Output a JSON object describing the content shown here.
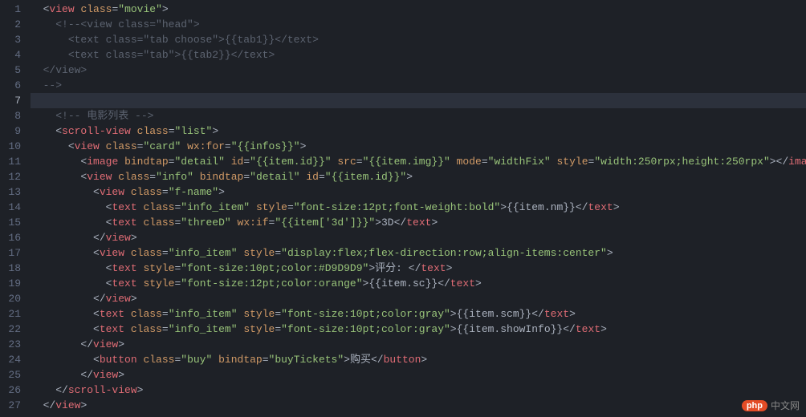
{
  "editor": {
    "highlighted_line": 7,
    "lines": [
      {
        "n": 1,
        "indent": 1,
        "tokens": [
          {
            "t": "p",
            "v": "<"
          },
          {
            "t": "tag",
            "v": "view"
          },
          {
            "t": "p",
            "v": " "
          },
          {
            "t": "attr",
            "v": "class"
          },
          {
            "t": "p",
            "v": "="
          },
          {
            "t": "str",
            "v": "\"movie\""
          },
          {
            "t": "p",
            "v": ">"
          }
        ]
      },
      {
        "n": 2,
        "indent": 2,
        "tokens": [
          {
            "t": "cmt",
            "v": "<!--<view class=\"head\">"
          }
        ]
      },
      {
        "n": 3,
        "indent": 2,
        "tokens": [
          {
            "t": "cmt",
            "v": "  <text class=\"tab choose\">{{tab1}}</text>"
          }
        ]
      },
      {
        "n": 4,
        "indent": 2,
        "tokens": [
          {
            "t": "cmt",
            "v": "  <text class=\"tab\">{{tab2}}</text>"
          }
        ]
      },
      {
        "n": 5,
        "indent": 1,
        "tokens": [
          {
            "t": "cmt",
            "v": "</view>"
          }
        ]
      },
      {
        "n": 6,
        "indent": 1,
        "tokens": [
          {
            "t": "cmt",
            "v": "-->"
          }
        ]
      },
      {
        "n": 7,
        "indent": 0,
        "tokens": []
      },
      {
        "n": 8,
        "indent": 2,
        "tokens": [
          {
            "t": "cmt",
            "v": "<!-- 电影列表 -->"
          }
        ]
      },
      {
        "n": 9,
        "indent": 2,
        "tokens": [
          {
            "t": "p",
            "v": "<"
          },
          {
            "t": "tag",
            "v": "scroll-view"
          },
          {
            "t": "p",
            "v": " "
          },
          {
            "t": "attr",
            "v": "class"
          },
          {
            "t": "p",
            "v": "="
          },
          {
            "t": "str",
            "v": "\"list\""
          },
          {
            "t": "p",
            "v": ">"
          }
        ]
      },
      {
        "n": 10,
        "indent": 3,
        "tokens": [
          {
            "t": "p",
            "v": "<"
          },
          {
            "t": "tag",
            "v": "view"
          },
          {
            "t": "p",
            "v": " "
          },
          {
            "t": "attr",
            "v": "class"
          },
          {
            "t": "p",
            "v": "="
          },
          {
            "t": "str",
            "v": "\"card\""
          },
          {
            "t": "p",
            "v": " "
          },
          {
            "t": "attr",
            "v": "wx:for"
          },
          {
            "t": "p",
            "v": "="
          },
          {
            "t": "str",
            "v": "\"{{infos}}\""
          },
          {
            "t": "p",
            "v": ">"
          }
        ]
      },
      {
        "n": 11,
        "indent": 4,
        "tokens": [
          {
            "t": "p",
            "v": "<"
          },
          {
            "t": "tag",
            "v": "image"
          },
          {
            "t": "p",
            "v": " "
          },
          {
            "t": "attr",
            "v": "bindtap"
          },
          {
            "t": "p",
            "v": "="
          },
          {
            "t": "str",
            "v": "\"detail\""
          },
          {
            "t": "p",
            "v": " "
          },
          {
            "t": "attr",
            "v": "id"
          },
          {
            "t": "p",
            "v": "="
          },
          {
            "t": "str",
            "v": "\"{{item.id}}\""
          },
          {
            "t": "p",
            "v": " "
          },
          {
            "t": "attr",
            "v": "src"
          },
          {
            "t": "p",
            "v": "="
          },
          {
            "t": "str",
            "v": "\"{{item.img}}\""
          },
          {
            "t": "p",
            "v": " "
          },
          {
            "t": "attr",
            "v": "mode"
          },
          {
            "t": "p",
            "v": "="
          },
          {
            "t": "str",
            "v": "\"widthFix\""
          },
          {
            "t": "p",
            "v": " "
          },
          {
            "t": "attr",
            "v": "style"
          },
          {
            "t": "p",
            "v": "="
          },
          {
            "t": "str",
            "v": "\"width:250rpx;height:250rpx\""
          },
          {
            "t": "p",
            "v": "></"
          },
          {
            "t": "tag",
            "v": "image"
          },
          {
            "t": "p",
            "v": ">"
          }
        ]
      },
      {
        "n": 12,
        "indent": 4,
        "tokens": [
          {
            "t": "p",
            "v": "<"
          },
          {
            "t": "tag",
            "v": "view"
          },
          {
            "t": "p",
            "v": " "
          },
          {
            "t": "attr",
            "v": "class"
          },
          {
            "t": "p",
            "v": "="
          },
          {
            "t": "str",
            "v": "\"info\""
          },
          {
            "t": "p",
            "v": " "
          },
          {
            "t": "attr",
            "v": "bindtap"
          },
          {
            "t": "p",
            "v": "="
          },
          {
            "t": "str",
            "v": "\"detail\""
          },
          {
            "t": "p",
            "v": " "
          },
          {
            "t": "attr",
            "v": "id"
          },
          {
            "t": "p",
            "v": "="
          },
          {
            "t": "str",
            "v": "\"{{item.id}}\""
          },
          {
            "t": "p",
            "v": ">"
          }
        ]
      },
      {
        "n": 13,
        "indent": 5,
        "tokens": [
          {
            "t": "p",
            "v": "<"
          },
          {
            "t": "tag",
            "v": "view"
          },
          {
            "t": "p",
            "v": " "
          },
          {
            "t": "attr",
            "v": "class"
          },
          {
            "t": "p",
            "v": "="
          },
          {
            "t": "str",
            "v": "\"f-name\""
          },
          {
            "t": "p",
            "v": ">"
          }
        ]
      },
      {
        "n": 14,
        "indent": 6,
        "tokens": [
          {
            "t": "p",
            "v": "<"
          },
          {
            "t": "tag",
            "v": "text"
          },
          {
            "t": "p",
            "v": " "
          },
          {
            "t": "attr",
            "v": "class"
          },
          {
            "t": "p",
            "v": "="
          },
          {
            "t": "str",
            "v": "\"info_item\""
          },
          {
            "t": "p",
            "v": " "
          },
          {
            "t": "attr",
            "v": "style"
          },
          {
            "t": "p",
            "v": "="
          },
          {
            "t": "str",
            "v": "\"font-size:12pt;font-weight:bold\""
          },
          {
            "t": "p",
            "v": ">"
          },
          {
            "t": "txt",
            "v": "{{item.nm}}"
          },
          {
            "t": "p",
            "v": "</"
          },
          {
            "t": "tag",
            "v": "text"
          },
          {
            "t": "p",
            "v": ">"
          }
        ]
      },
      {
        "n": 15,
        "indent": 6,
        "tokens": [
          {
            "t": "p",
            "v": "<"
          },
          {
            "t": "tag",
            "v": "text"
          },
          {
            "t": "p",
            "v": " "
          },
          {
            "t": "attr",
            "v": "class"
          },
          {
            "t": "p",
            "v": "="
          },
          {
            "t": "str",
            "v": "\"threeD\""
          },
          {
            "t": "p",
            "v": " "
          },
          {
            "t": "attr",
            "v": "wx:if"
          },
          {
            "t": "p",
            "v": "="
          },
          {
            "t": "str",
            "v": "\"{{item['3d']}}\""
          },
          {
            "t": "p",
            "v": ">"
          },
          {
            "t": "txt",
            "v": "3D"
          },
          {
            "t": "p",
            "v": "</"
          },
          {
            "t": "tag",
            "v": "text"
          },
          {
            "t": "p",
            "v": ">"
          }
        ]
      },
      {
        "n": 16,
        "indent": 5,
        "tokens": [
          {
            "t": "p",
            "v": "</"
          },
          {
            "t": "tag",
            "v": "view"
          },
          {
            "t": "p",
            "v": ">"
          }
        ]
      },
      {
        "n": 17,
        "indent": 5,
        "tokens": [
          {
            "t": "p",
            "v": "<"
          },
          {
            "t": "tag",
            "v": "view"
          },
          {
            "t": "p",
            "v": " "
          },
          {
            "t": "attr",
            "v": "class"
          },
          {
            "t": "p",
            "v": "="
          },
          {
            "t": "str",
            "v": "\"info_item\""
          },
          {
            "t": "p",
            "v": " "
          },
          {
            "t": "attr",
            "v": "style"
          },
          {
            "t": "p",
            "v": "="
          },
          {
            "t": "str",
            "v": "\"display:flex;flex-direction:row;align-items:center\""
          },
          {
            "t": "p",
            "v": ">"
          }
        ]
      },
      {
        "n": 18,
        "indent": 6,
        "tokens": [
          {
            "t": "p",
            "v": "<"
          },
          {
            "t": "tag",
            "v": "text"
          },
          {
            "t": "p",
            "v": " "
          },
          {
            "t": "attr",
            "v": "style"
          },
          {
            "t": "p",
            "v": "="
          },
          {
            "t": "str",
            "v": "\"font-size:10pt;color:#D9D9D9\""
          },
          {
            "t": "p",
            "v": ">"
          },
          {
            "t": "txt",
            "v": "评分: "
          },
          {
            "t": "p",
            "v": "</"
          },
          {
            "t": "tag",
            "v": "text"
          },
          {
            "t": "p",
            "v": ">"
          }
        ]
      },
      {
        "n": 19,
        "indent": 6,
        "tokens": [
          {
            "t": "p",
            "v": "<"
          },
          {
            "t": "tag",
            "v": "text"
          },
          {
            "t": "p",
            "v": " "
          },
          {
            "t": "attr",
            "v": "style"
          },
          {
            "t": "p",
            "v": "="
          },
          {
            "t": "str",
            "v": "\"font-size:12pt;color:orange\""
          },
          {
            "t": "p",
            "v": ">"
          },
          {
            "t": "txt",
            "v": "{{item.sc}}"
          },
          {
            "t": "p",
            "v": "</"
          },
          {
            "t": "tag",
            "v": "text"
          },
          {
            "t": "p",
            "v": ">"
          }
        ]
      },
      {
        "n": 20,
        "indent": 5,
        "tokens": [
          {
            "t": "p",
            "v": "</"
          },
          {
            "t": "tag",
            "v": "view"
          },
          {
            "t": "p",
            "v": ">"
          }
        ]
      },
      {
        "n": 21,
        "indent": 5,
        "tokens": [
          {
            "t": "p",
            "v": "<"
          },
          {
            "t": "tag",
            "v": "text"
          },
          {
            "t": "p",
            "v": " "
          },
          {
            "t": "attr",
            "v": "class"
          },
          {
            "t": "p",
            "v": "="
          },
          {
            "t": "str",
            "v": "\"info_item\""
          },
          {
            "t": "p",
            "v": " "
          },
          {
            "t": "attr",
            "v": "style"
          },
          {
            "t": "p",
            "v": "="
          },
          {
            "t": "str",
            "v": "\"font-size:10pt;color:gray\""
          },
          {
            "t": "p",
            "v": ">"
          },
          {
            "t": "txt",
            "v": "{{item.scm}}"
          },
          {
            "t": "p",
            "v": "</"
          },
          {
            "t": "tag",
            "v": "text"
          },
          {
            "t": "p",
            "v": ">"
          }
        ]
      },
      {
        "n": 22,
        "indent": 5,
        "tokens": [
          {
            "t": "p",
            "v": "<"
          },
          {
            "t": "tag",
            "v": "text"
          },
          {
            "t": "p",
            "v": " "
          },
          {
            "t": "attr",
            "v": "class"
          },
          {
            "t": "p",
            "v": "="
          },
          {
            "t": "str",
            "v": "\"info_item\""
          },
          {
            "t": "p",
            "v": " "
          },
          {
            "t": "attr",
            "v": "style"
          },
          {
            "t": "p",
            "v": "="
          },
          {
            "t": "str",
            "v": "\"font-size:10pt;color:gray\""
          },
          {
            "t": "p",
            "v": ">"
          },
          {
            "t": "txt",
            "v": "{{item.showInfo}}"
          },
          {
            "t": "p",
            "v": "</"
          },
          {
            "t": "tag",
            "v": "text"
          },
          {
            "t": "p",
            "v": ">"
          }
        ]
      },
      {
        "n": 23,
        "indent": 4,
        "tokens": [
          {
            "t": "p",
            "v": "</"
          },
          {
            "t": "tag",
            "v": "view"
          },
          {
            "t": "p",
            "v": ">"
          }
        ]
      },
      {
        "n": 24,
        "indent": 5,
        "tokens": [
          {
            "t": "p",
            "v": "<"
          },
          {
            "t": "tag",
            "v": "button"
          },
          {
            "t": "p",
            "v": " "
          },
          {
            "t": "attr",
            "v": "class"
          },
          {
            "t": "p",
            "v": "="
          },
          {
            "t": "str",
            "v": "\"buy\""
          },
          {
            "t": "p",
            "v": " "
          },
          {
            "t": "attr",
            "v": "bindtap"
          },
          {
            "t": "p",
            "v": "="
          },
          {
            "t": "str",
            "v": "\"buyTickets\""
          },
          {
            "t": "p",
            "v": ">"
          },
          {
            "t": "txt",
            "v": "购买"
          },
          {
            "t": "p",
            "v": "</"
          },
          {
            "t": "tag",
            "v": "button"
          },
          {
            "t": "p",
            "v": ">"
          }
        ]
      },
      {
        "n": 25,
        "indent": 4,
        "tokens": [
          {
            "t": "p",
            "v": "</"
          },
          {
            "t": "tag",
            "v": "view"
          },
          {
            "t": "p",
            "v": ">"
          }
        ]
      },
      {
        "n": 26,
        "indent": 2,
        "tokens": [
          {
            "t": "p",
            "v": "</"
          },
          {
            "t": "tag",
            "v": "scroll-view"
          },
          {
            "t": "p",
            "v": ">"
          }
        ]
      },
      {
        "n": 27,
        "indent": 1,
        "tokens": [
          {
            "t": "p",
            "v": "</"
          },
          {
            "t": "tag",
            "v": "view"
          },
          {
            "t": "p",
            "v": ">"
          }
        ]
      }
    ]
  },
  "watermark": {
    "badge": "php",
    "text": "中文网"
  }
}
